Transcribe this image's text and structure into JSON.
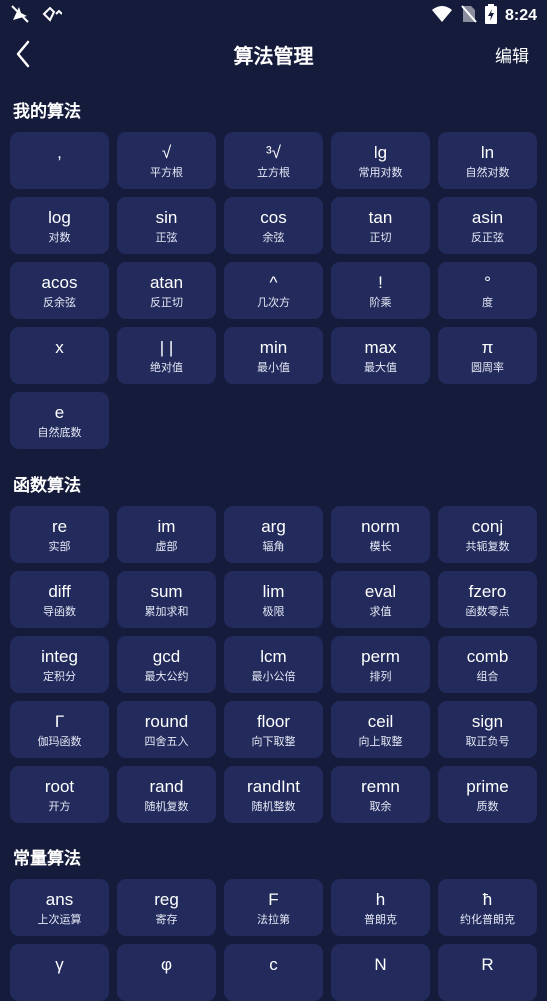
{
  "status_bar": {
    "time": "8:24"
  },
  "header": {
    "title": "算法管理",
    "edit_label": "编辑"
  },
  "sections": {
    "my": {
      "title": "我的算法",
      "items": [
        {
          "sym": ",",
          "desc": ""
        },
        {
          "sym": "√",
          "desc": "平方根"
        },
        {
          "sym": "³√",
          "desc": "立方根"
        },
        {
          "sym": "lg",
          "desc": "常用对数"
        },
        {
          "sym": "ln",
          "desc": "自然对数"
        },
        {
          "sym": "log",
          "desc": "对数"
        },
        {
          "sym": "sin",
          "desc": "正弦"
        },
        {
          "sym": "cos",
          "desc": "余弦"
        },
        {
          "sym": "tan",
          "desc": "正切"
        },
        {
          "sym": "asin",
          "desc": "反正弦"
        },
        {
          "sym": "acos",
          "desc": "反余弦"
        },
        {
          "sym": "atan",
          "desc": "反正切"
        },
        {
          "sym": "^",
          "desc": "几次方"
        },
        {
          "sym": "!",
          "desc": "阶乘"
        },
        {
          "sym": "°",
          "desc": "度"
        },
        {
          "sym": "x",
          "desc": ""
        },
        {
          "sym": "| |",
          "desc": "绝对值"
        },
        {
          "sym": "min",
          "desc": "最小值"
        },
        {
          "sym": "max",
          "desc": "最大值"
        },
        {
          "sym": "π",
          "desc": "圆周率"
        },
        {
          "sym": "e",
          "desc": "自然底数"
        }
      ]
    },
    "func": {
      "title": "函数算法",
      "items": [
        {
          "sym": "re",
          "desc": "实部"
        },
        {
          "sym": "im",
          "desc": "虚部"
        },
        {
          "sym": "arg",
          "desc": "辐角"
        },
        {
          "sym": "norm",
          "desc": "模长"
        },
        {
          "sym": "conj",
          "desc": "共轭复数"
        },
        {
          "sym": "diff",
          "desc": "导函数"
        },
        {
          "sym": "sum",
          "desc": "累加求和"
        },
        {
          "sym": "lim",
          "desc": "极限"
        },
        {
          "sym": "eval",
          "desc": "求值"
        },
        {
          "sym": "fzero",
          "desc": "函数零点"
        },
        {
          "sym": "integ",
          "desc": "定积分"
        },
        {
          "sym": "gcd",
          "desc": "最大公约"
        },
        {
          "sym": "lcm",
          "desc": "最小公倍"
        },
        {
          "sym": "perm",
          "desc": "排列"
        },
        {
          "sym": "comb",
          "desc": "组合"
        },
        {
          "sym": "Γ",
          "desc": "伽玛函数"
        },
        {
          "sym": "round",
          "desc": "四舍五入"
        },
        {
          "sym": "floor",
          "desc": "向下取整"
        },
        {
          "sym": "ceil",
          "desc": "向上取整"
        },
        {
          "sym": "sign",
          "desc": "取正负号"
        },
        {
          "sym": "root",
          "desc": "开方"
        },
        {
          "sym": "rand",
          "desc": "随机复数"
        },
        {
          "sym": "randInt",
          "desc": "随机整数"
        },
        {
          "sym": "remn",
          "desc": "取余"
        },
        {
          "sym": "prime",
          "desc": "质数"
        }
      ]
    },
    "const": {
      "title": "常量算法",
      "items": [
        {
          "sym": "ans",
          "desc": "上次运算"
        },
        {
          "sym": "reg",
          "desc": "寄存"
        },
        {
          "sym": "F",
          "desc": "法拉第"
        },
        {
          "sym": "h",
          "desc": "普朗克"
        },
        {
          "sym": "ħ",
          "desc": "约化普朗克"
        },
        {
          "sym": "γ",
          "desc": ""
        },
        {
          "sym": "φ",
          "desc": ""
        },
        {
          "sym": "c",
          "desc": ""
        },
        {
          "sym": "N",
          "desc": ""
        },
        {
          "sym": "R",
          "desc": ""
        }
      ]
    }
  }
}
